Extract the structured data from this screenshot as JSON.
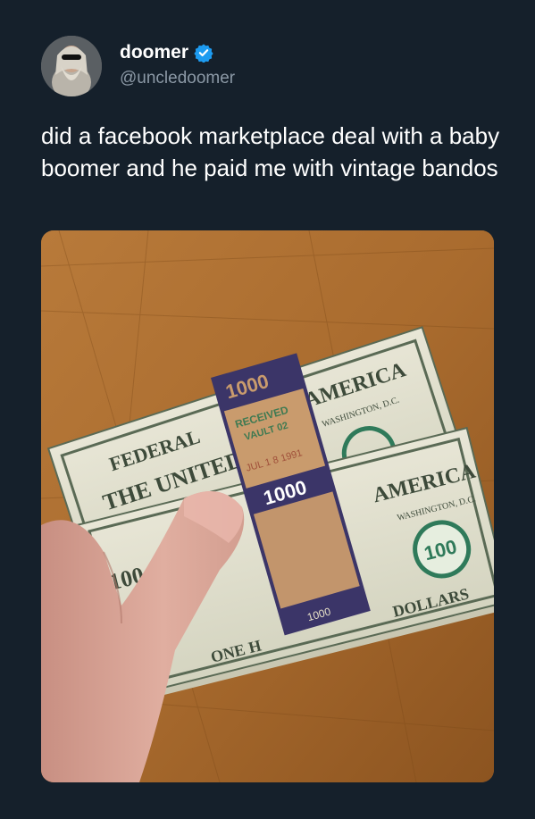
{
  "tweet": {
    "display_name": "doomer",
    "handle": "@uncledoomer",
    "text": "did a facebook marketplace deal with a baby boomer and he paid me with vintage bandos",
    "verified": true,
    "verified_color": "#1d9bf0"
  },
  "media": {
    "band_label": "1000",
    "stamp_line1": "RECEIVED",
    "stamp_line2": "VAULT 02",
    "stamp_date": "JUL 1 8 1991",
    "note_text_federal": "FEDERAL",
    "note_text_united": "THE UNITED",
    "note_text_america": "AMERICA",
    "note_text_washington": "WASHINGTON, D.C.",
    "note_denomination": "100",
    "note_text_dollars": "DOLLARS",
    "note_text_one": "ONE H"
  },
  "colors": {
    "background": "#15202b",
    "text_primary": "#ffffff",
    "text_secondary": "#8b98a5",
    "band": "#3b3568",
    "band_paper": "#c99b6d",
    "wood": "#a0662a"
  }
}
